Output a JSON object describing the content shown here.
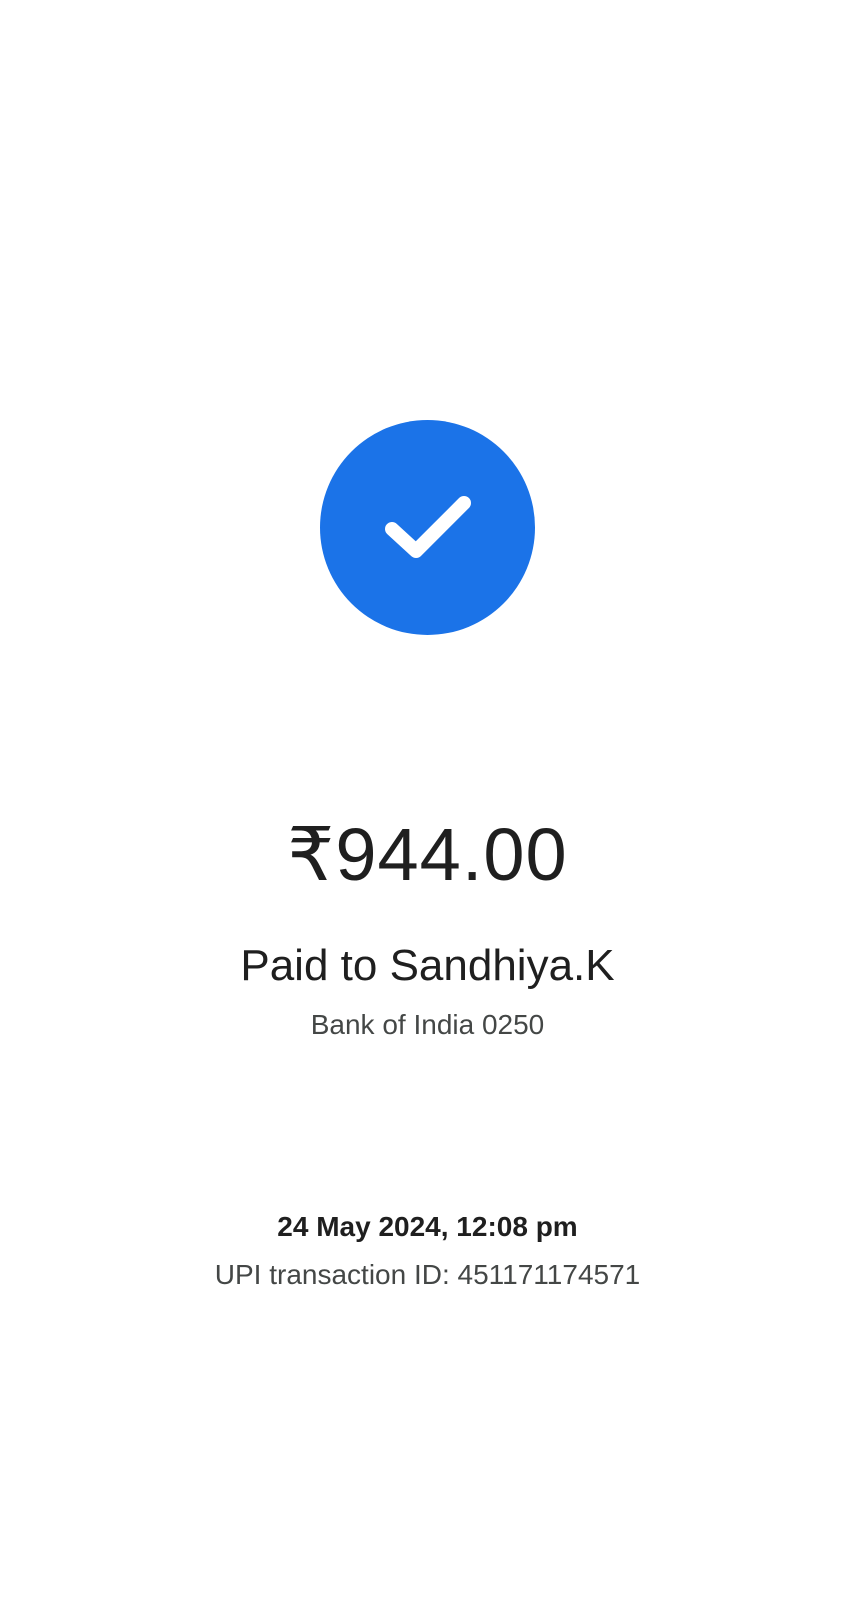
{
  "status": {
    "icon": "check-icon",
    "accent_color": "#1b73e8"
  },
  "payment": {
    "amount": "₹944.00",
    "payee": "Paid to Sandhiya.K",
    "bank": "Bank of India 0250",
    "datetime": "24 May 2024, 12:08 pm",
    "transaction_id": "UPI transaction ID: 451171174571"
  }
}
